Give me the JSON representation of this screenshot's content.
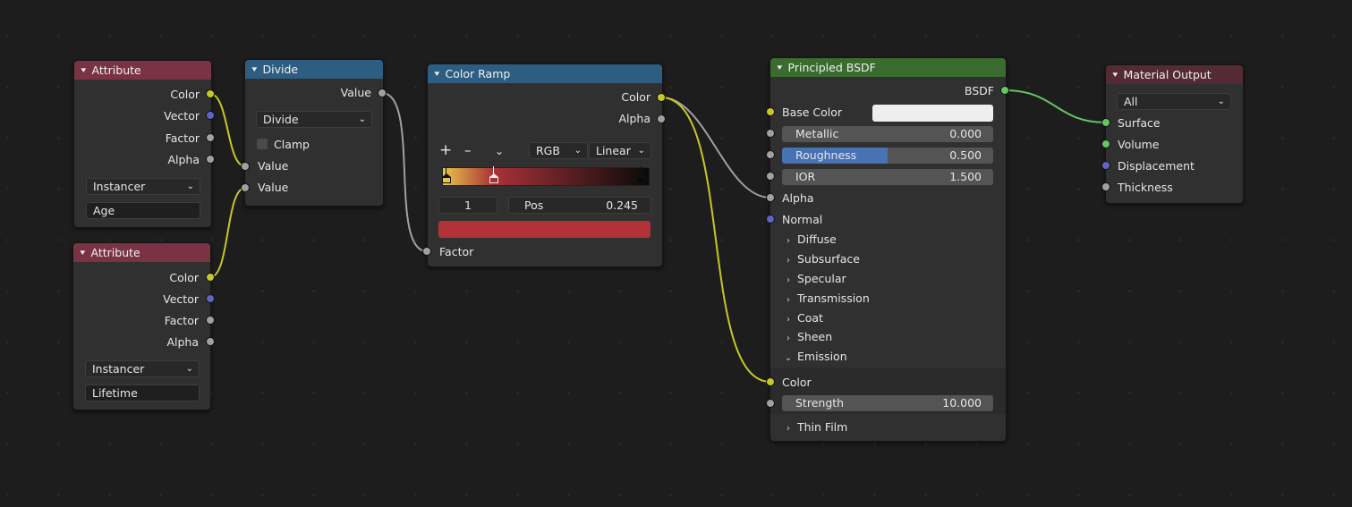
{
  "nodes": {
    "attribute_age": {
      "title": "Attribute",
      "outputs": [
        "Color",
        "Vector",
        "Factor",
        "Alpha"
      ],
      "type_value": "Instancer",
      "name_value": "Age"
    },
    "attribute_lifetime": {
      "title": "Attribute",
      "outputs": [
        "Color",
        "Vector",
        "Factor",
        "Alpha"
      ],
      "type_value": "Instancer",
      "name_value": "Lifetime"
    },
    "divide": {
      "title": "Divide",
      "output": "Value",
      "operation": "Divide",
      "clamp_label": "Clamp",
      "clamp_checked": false,
      "inputs": [
        "Value",
        "Value"
      ]
    },
    "color_ramp": {
      "title": "Color Ramp",
      "outputs": [
        "Color",
        "Alpha"
      ],
      "add_glyph": "+",
      "remove_glyph": "–",
      "color_mode": "RGB",
      "interpolation": "Linear",
      "stops": [
        {
          "pos": 0.0,
          "color": "#e8c64a"
        },
        {
          "pos": 0.245,
          "color": "#a83238"
        },
        {
          "pos": 1.0,
          "color": "#0a0a0a"
        }
      ],
      "active_index": "1",
      "pos_label": "Pos",
      "pos_value": "0.245",
      "active_color": "#b13338",
      "input": "Factor"
    },
    "principled": {
      "title": "Principled BSDF",
      "output": "BSDF",
      "base_color_label": "Base Color",
      "base_color": "#eeeeee",
      "metallic": {
        "label": "Metallic",
        "value": "0.000",
        "fraction": 0.0
      },
      "roughness": {
        "label": "Roughness",
        "value": "0.500",
        "fraction": 0.5
      },
      "ior": {
        "label": "IOR",
        "value": "1.500",
        "fraction": 0.0
      },
      "alpha_label": "Alpha",
      "normal_label": "Normal",
      "panels": [
        "Diffuse",
        "Subsurface",
        "Specular",
        "Transmission",
        "Coat",
        "Sheen"
      ],
      "emission_label": "Emission",
      "emission_color_label": "Color",
      "strength": {
        "label": "Strength",
        "value": "10.000",
        "fraction": 0.0
      },
      "thin_film_label": "Thin Film"
    },
    "material_output": {
      "title": "Material Output",
      "target": "All",
      "inputs": [
        "Surface",
        "Volume",
        "Displacement",
        "Thickness"
      ]
    }
  },
  "icons": {
    "collapse": "▾",
    "panel_closed": "›",
    "panel_open": "⌄",
    "dropdown": "⌄"
  },
  "colors": {
    "attribute_header": "#7a3344",
    "math_header": "#2d5e82",
    "shader_header": "#3a6b2f",
    "output_header": "#542a34",
    "wire_color": "#c7c729",
    "wire_float": "#a1a1a1",
    "wire_shader": "#63c763",
    "roughness_fill": "#4772b3"
  }
}
